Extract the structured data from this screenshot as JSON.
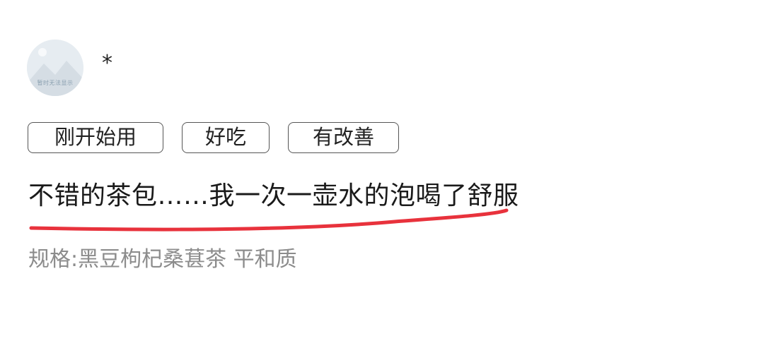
{
  "user": {
    "avatar_caption": "暂时无法显示",
    "name": "*"
  },
  "tags": [
    "刚开始用",
    "好吃",
    "有改善"
  ],
  "review": {
    "text": "不错的茶包……我一次一壶水的泡喝了舒服"
  },
  "spec": {
    "text": "规格:黑豆枸杞桑葚茶 平和质"
  },
  "colors": {
    "underline": "#e8323c",
    "tag_border": "#555555",
    "spec_text": "#8c8c8c"
  }
}
